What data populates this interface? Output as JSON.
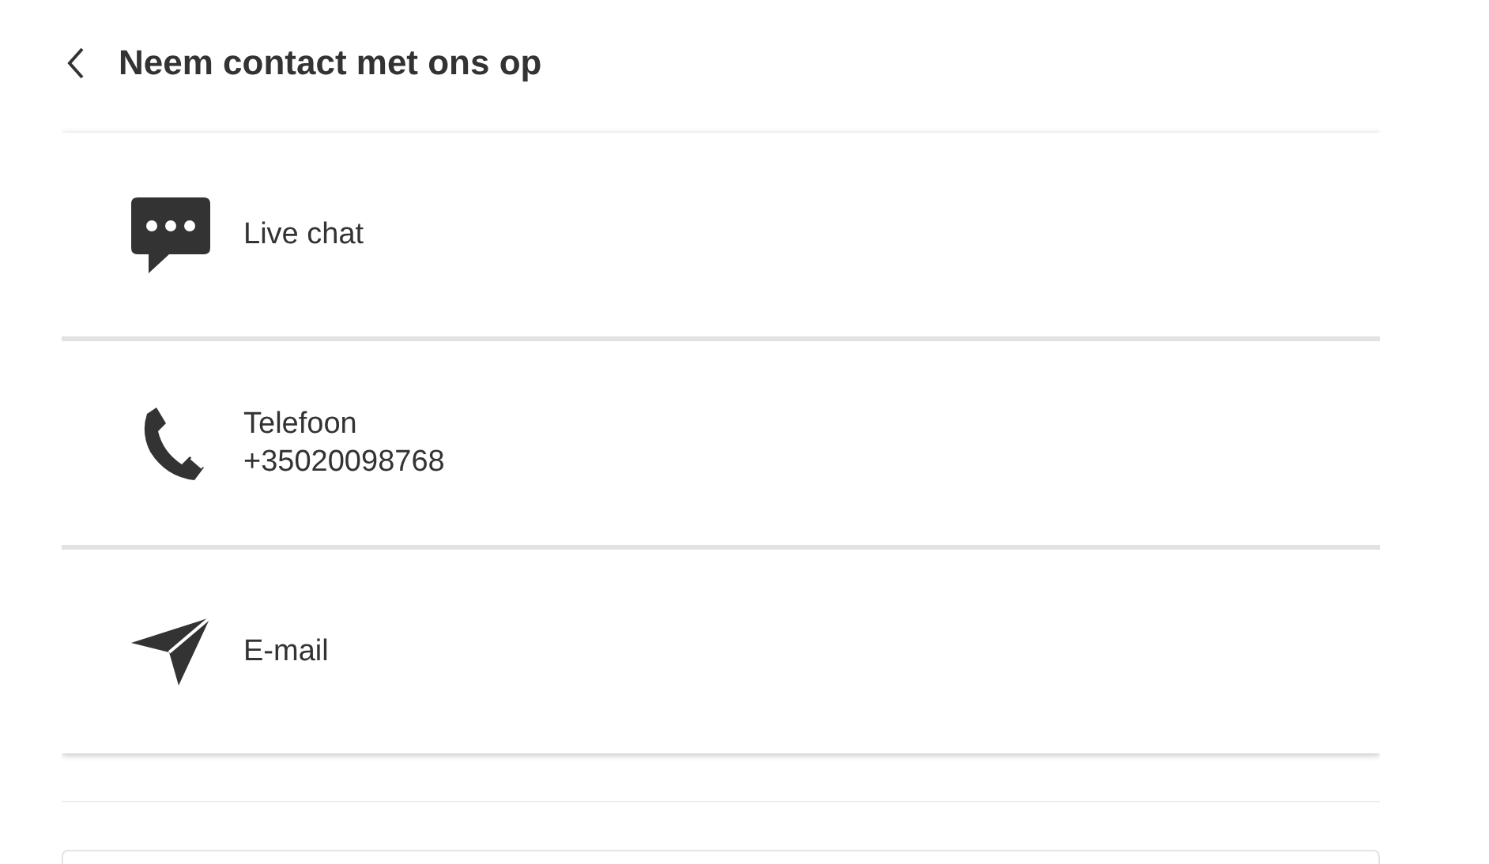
{
  "header": {
    "title": "Neem contact met ons op"
  },
  "options": [
    {
      "kind": "chat",
      "label": "Live chat"
    },
    {
      "kind": "phone",
      "label": "Telefoon",
      "detail": "+35020098768"
    },
    {
      "kind": "email",
      "label": "E-mail"
    }
  ]
}
